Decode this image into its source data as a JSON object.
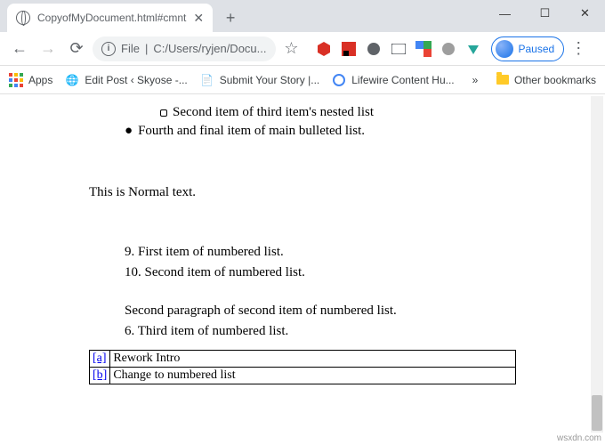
{
  "tab": {
    "title": "CopyofMyDocument.html#cmnt"
  },
  "window_controls": {
    "min": "—",
    "max": "☐",
    "close": "✕"
  },
  "toolbar": {
    "address_prefix": "File",
    "address_path": "C:/Users/ryjen/Docu...",
    "paused_label": "Paused"
  },
  "bookmarks": {
    "apps": "Apps",
    "items": [
      {
        "label": "Edit Post ‹ Skyose -..."
      },
      {
        "label": "Submit Your Story |..."
      },
      {
        "label": "Lifewire Content Hu..."
      }
    ],
    "overflow": "»",
    "other": "Other bookmarks"
  },
  "document": {
    "nested_item": "Second item of third item's nested list",
    "fourth_item": "Fourth and final item of main bulleted list.",
    "normal_text": "This is Normal text.",
    "ol_1": "9. First item of numbered list.",
    "ol_2": "10. Second item of numbered list.",
    "ol_para": "Second paragraph of second item of numbered list.",
    "ol_3": "6. Third item of numbered list.",
    "comments": [
      {
        "ref": "[a]",
        "text": "Rework Intro"
      },
      {
        "ref": "[b]",
        "text": "Change to numbered list"
      }
    ]
  },
  "watermark": "wsxdn.com"
}
